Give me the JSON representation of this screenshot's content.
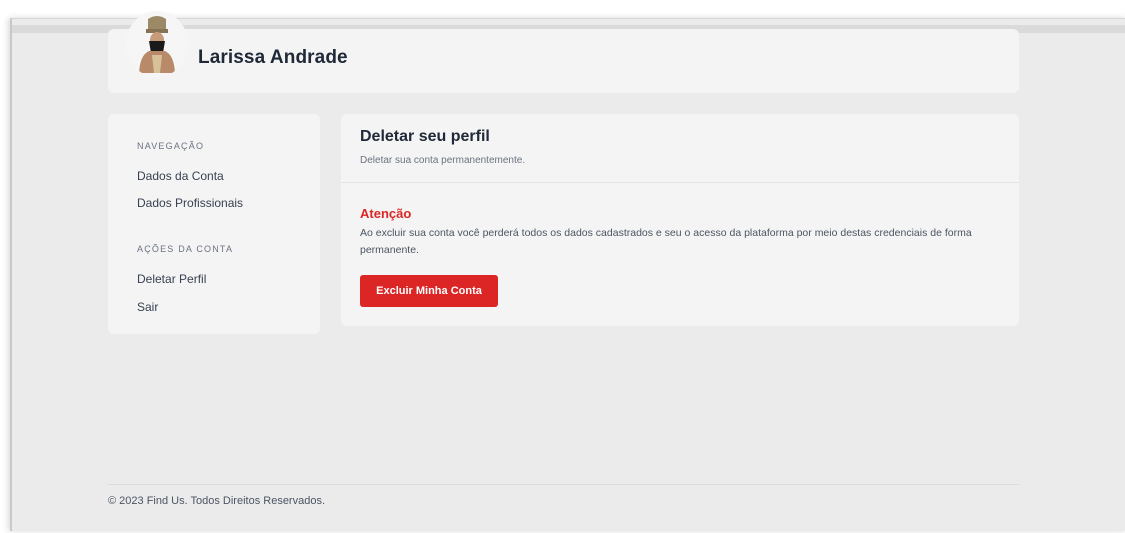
{
  "user": {
    "name": "Larissa Andrade"
  },
  "sidebar": {
    "sections": [
      {
        "title": "NAVEGAÇÃO",
        "items": [
          {
            "label": "Dados da Conta"
          },
          {
            "label": "Dados Profissionais"
          }
        ]
      },
      {
        "title": "AÇÕES DA CONTA",
        "items": [
          {
            "label": "Deletar Perfil"
          },
          {
            "label": "Sair"
          }
        ]
      }
    ]
  },
  "main": {
    "title": "Deletar seu perfil",
    "subtitle": "Deletar sua conta permanentemente.",
    "warning_title": "Atenção",
    "warning_text": "Ao excluir sua conta você perderá todos os dados cadastrados e seu o acesso da plataforma por meio destas credenciais de forma permanente.",
    "button_label": "Excluir Minha Conta"
  },
  "footer": {
    "text": "© 2023 Find Us. Todos Direitos Reservados."
  },
  "colors": {
    "danger": "#dc2626",
    "card": "#f4f4f4",
    "background": "#ebebeb"
  }
}
